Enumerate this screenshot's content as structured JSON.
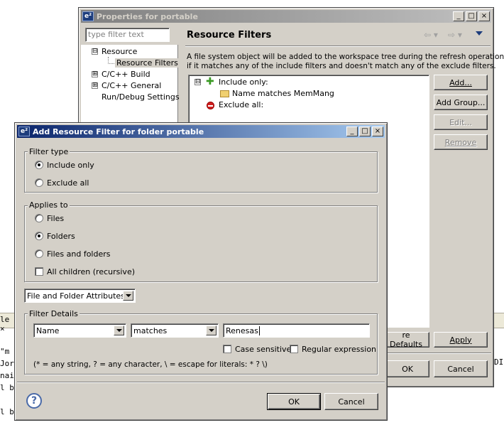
{
  "background": {
    "tab_label": "le ×",
    "code_lines": [
      "\"m",
      "Jor",
      "nai",
      "l b",
      "",
      "l b"
    ],
    "right_fragment": "DI"
  },
  "properties": {
    "title": "Properties for portable",
    "filter_placeholder": "type filter text",
    "tree": [
      {
        "label": "Resource",
        "expander": "⊟"
      },
      {
        "label": "Resource Filters"
      },
      {
        "label": "C/C++ Build",
        "expander": "⊞"
      },
      {
        "label": "C/C++ General",
        "expander": "⊞"
      },
      {
        "label": "Run/Debug Settings"
      }
    ],
    "page_title": "Resource Filters",
    "description_line1": "A file system object will be added to the workspace tree during the refresh operation",
    "description_line2": "if it matches any of the include filters and doesn't match any of the exclude filters.",
    "filters_tree": {
      "include_label": "Include only:",
      "include_child": "Name matches MemMang",
      "exclude_label": "Exclude all:"
    },
    "buttons": {
      "add": "Add...",
      "add_group": "Add Group...",
      "edit": "Edit...",
      "remove": "Remove",
      "restore_defaults": "re Defaults",
      "apply": "Apply",
      "ok": "OK",
      "cancel": "Cancel"
    }
  },
  "dialog": {
    "title": "Add Resource Filter for folder portable",
    "filter_type": {
      "label": "Filter type",
      "options": [
        "Include only",
        "Exclude all"
      ],
      "selected": "Include only"
    },
    "applies_to": {
      "label": "Applies to",
      "options": [
        "Files",
        "Folders",
        "Files and folders"
      ],
      "selected": "Folders",
      "recursive_label": "All children (recursive)"
    },
    "attribute_select": "File and Folder Attributes",
    "filter_details": {
      "label": "Filter Details",
      "attribute": "Name",
      "operator": "matches",
      "value": "Renesas",
      "case_sensitive": "Case sensitive",
      "regex": "Regular expression",
      "hint": "(* = any string, ? = any character, \\ = escape for literals: * ? \\)"
    },
    "buttons": {
      "ok": "OK",
      "cancel": "Cancel"
    }
  },
  "colors": {
    "active_title": "#0a246a",
    "inactive_title": "#808080",
    "face": "#d4d0c8"
  }
}
